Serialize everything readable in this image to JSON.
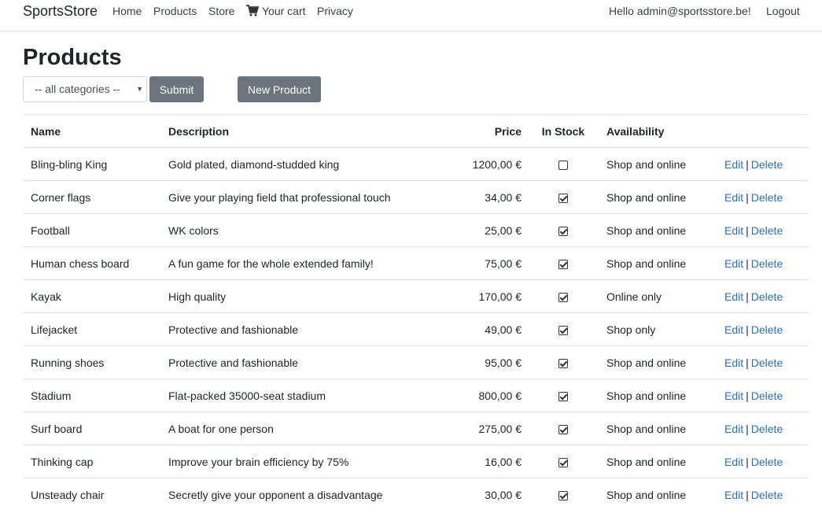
{
  "nav": {
    "brand": "SportsStore",
    "home": "Home",
    "products": "Products",
    "store": "Store",
    "cart": "Your cart",
    "privacy": "Privacy",
    "greeting": "Hello admin@sportsstore.be!",
    "logout": "Logout"
  },
  "page": {
    "title": "Products",
    "category_select": "-- all categories --",
    "submit": "Submit",
    "new_product": "New Product"
  },
  "table": {
    "headers": {
      "name": "Name",
      "description": "Description",
      "price": "Price",
      "in_stock": "In Stock",
      "availability": "Availability"
    },
    "edit_label": "Edit",
    "separator": "|",
    "delete_label": "Delete",
    "rows": [
      {
        "name": "Bling-bling King",
        "description": "Gold plated, diamond-studded king",
        "price": "1200,00 €",
        "in_stock": false,
        "availability": "Shop and online"
      },
      {
        "name": "Corner flags",
        "description": "Give your playing field that professional touch",
        "price": "34,00 €",
        "in_stock": true,
        "availability": "Shop and online"
      },
      {
        "name": "Football",
        "description": "WK colors",
        "price": "25,00 €",
        "in_stock": true,
        "availability": "Shop and online"
      },
      {
        "name": "Human chess board",
        "description": "A fun game for the whole extended family!",
        "price": "75,00 €",
        "in_stock": true,
        "availability": "Shop and online"
      },
      {
        "name": "Kayak",
        "description": "High quality",
        "price": "170,00 €",
        "in_stock": true,
        "availability": "Online only"
      },
      {
        "name": "Lifejacket",
        "description": "Protective and fashionable",
        "price": "49,00 €",
        "in_stock": true,
        "availability": "Shop only"
      },
      {
        "name": "Running shoes",
        "description": "Protective and fashionable",
        "price": "95,00 €",
        "in_stock": true,
        "availability": "Shop and online"
      },
      {
        "name": "Stadium",
        "description": "Flat-packed 35000-seat stadium",
        "price": "800,00 €",
        "in_stock": true,
        "availability": "Shop and online"
      },
      {
        "name": "Surf board",
        "description": "A boat for one person",
        "price": "275,00 €",
        "in_stock": true,
        "availability": "Shop and online"
      },
      {
        "name": "Thinking cap",
        "description": "Improve your brain efficiency by 75%",
        "price": "16,00 €",
        "in_stock": true,
        "availability": "Shop and online"
      },
      {
        "name": "Unsteady chair",
        "description": "Secretly give your opponent a disadvantage",
        "price": "30,00 €",
        "in_stock": true,
        "availability": "Shop and online"
      }
    ]
  },
  "colors": {
    "link": "#2a6fb8",
    "button_bg": "#6c757d",
    "border": "#dee2e6"
  },
  "icons": {
    "cart": "shopping-cart-icon"
  }
}
